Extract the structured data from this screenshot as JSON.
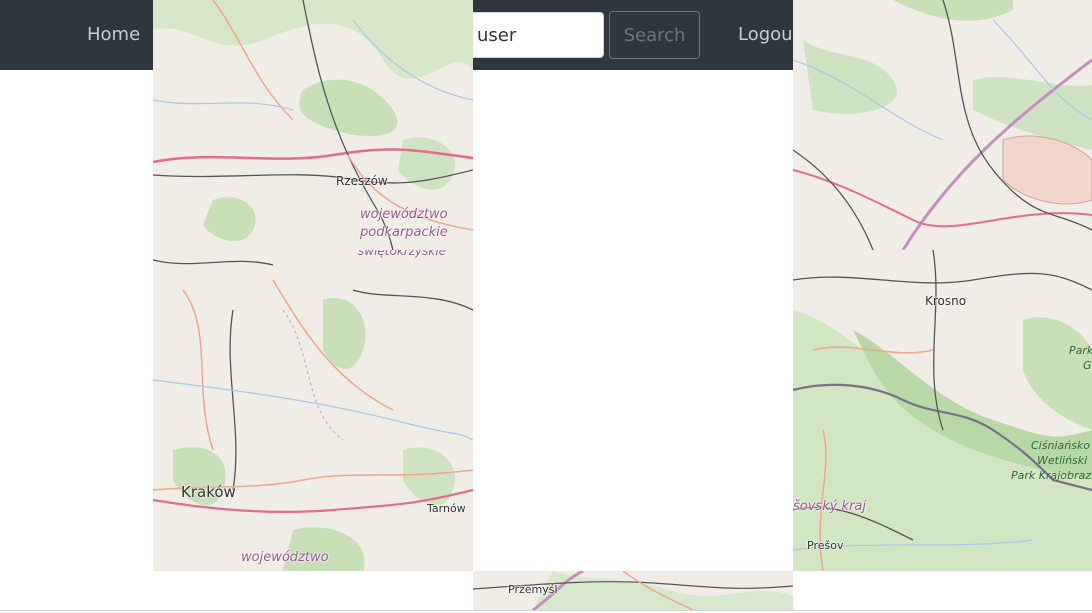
{
  "navbar": {
    "home_label": "Home",
    "search": {
      "value": "user",
      "placeholder": ""
    },
    "search_button_label": "Search",
    "logout_label": "Logout"
  },
  "map": {
    "labels": {
      "rzeszow": "Rzeszów",
      "wojewodztwo_1": "województwo",
      "podkarpackie": "podkarpackie",
      "swietokrzyskie": "świętokrzyskie",
      "krakow": "Kraków",
      "tarnow": "Tarnów",
      "wojewodztwo_2": "województwo",
      "krosno": "Krosno",
      "park_1": "Park",
      "park_2": "G",
      "cisnianski": "Ciśniańsko",
      "wetlinski": "Wetliński",
      "park_krajobrazowy": "Park Krajobraz",
      "presovsky": "šovský kraj",
      "presov": "Prešov",
      "przemysl": "Przemyśl"
    },
    "colors": {
      "land": "#f0ede6",
      "forest": "#c8dfb8",
      "road_primary": "#f2a58a",
      "motorway": "#e86a8c",
      "border": "#7b6f8a",
      "water": "#a9c8e8"
    }
  }
}
